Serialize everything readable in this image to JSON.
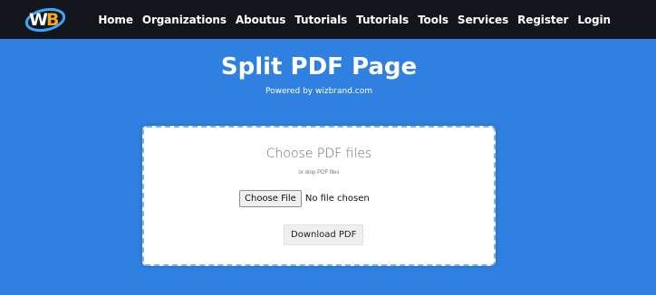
{
  "nav": {
    "logo_icon": "wb-logo-icon",
    "items": [
      "Home",
      "Organizations",
      "Aboutus",
      "Tutorials",
      "Tutorials",
      "Tools",
      "Services",
      "Register",
      "Login"
    ]
  },
  "hero": {
    "title": "Split PDF Page",
    "subtitle": "Powered by wizbrand.com"
  },
  "uploader": {
    "title": "Choose PDF files",
    "hint": "or drop PDF files",
    "choose_label": "Choose File",
    "file_status": "No file chosen",
    "download_label": "Download PDF"
  },
  "colors": {
    "navbar": "#12151c",
    "page_bg": "#2f80e0",
    "card_border": "#7fb4ea"
  }
}
